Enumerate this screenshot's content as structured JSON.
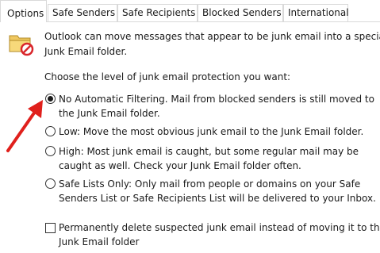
{
  "tabs": [
    {
      "label": "Options",
      "active": true
    },
    {
      "label": "Safe Senders",
      "active": false
    },
    {
      "label": "Safe Recipients",
      "active": false
    },
    {
      "label": "Blocked Senders",
      "active": false
    },
    {
      "label": "International",
      "active": false
    }
  ],
  "intro": {
    "line1": "Outlook can move messages that appear to be junk email into a special",
    "line2": "Junk Email folder."
  },
  "prompt": "Choose the level of junk email protection you want:",
  "options": {
    "no_filter": {
      "line1": "No Automatic Filtering. Mail from blocked senders is still moved to",
      "line2": "the Junk Email folder.",
      "selected": true
    },
    "low": {
      "line1": "Low: Move the most obvious junk email to the Junk Email folder.",
      "selected": false
    },
    "high": {
      "line1": "High: Most junk email is caught, but some regular mail may be",
      "line2": "caught as well. Check your Junk Email folder often.",
      "selected": false
    },
    "safe_lists": {
      "line1": "Safe Lists Only: Only mail from people or domains on your Safe",
      "line2": "Senders List or Safe Recipients List will be delivered to your Inbox.",
      "selected": false
    }
  },
  "permanent_delete": {
    "line1": "Permanently delete suspected junk email instead of moving it to the",
    "line2": "Junk Email folder",
    "checked": false
  },
  "colors": {
    "annotation_arrow": "#e0201c",
    "folder_icon": "#f0c860",
    "blocked_badge": "#d9262b"
  },
  "icons": {
    "folder": "junk-folder-icon",
    "arrow": "red-annotation-arrow"
  }
}
